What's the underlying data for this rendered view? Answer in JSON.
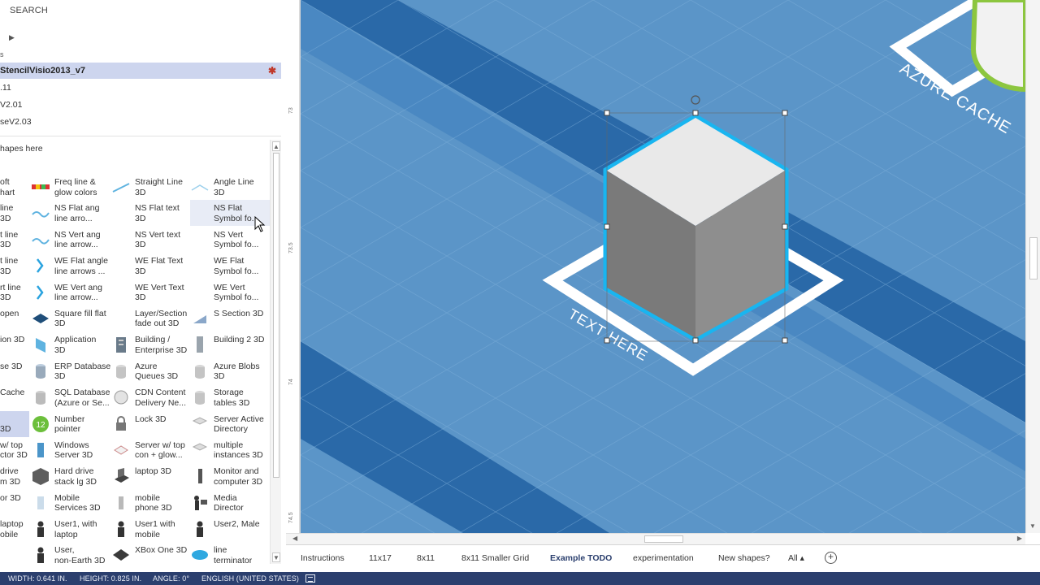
{
  "shapes_pane": {
    "search_label": "SEARCH",
    "expand_arrow": "▶",
    "tiny_mark": "s",
    "active_stencil": "StencilVisio2013_v7",
    "active_stencil_pin": "✱",
    "stencils": [
      ".11",
      "V2.01",
      "seV2.03"
    ],
    "drop_hint": "hapes here",
    "rows": [
      [
        "oft\nhart",
        "Freq line &\nglow colors",
        "Straight Line\n3D",
        "Angle Line\n3D"
      ],
      [
        "line\n3D",
        "NS Flat ang\nline arro...",
        "NS Flat text\n3D",
        "NS Flat\nSymbol fo..."
      ],
      [
        "t line\n3D",
        "NS Vert ang\nline arrow...",
        "NS Vert text\n3D",
        "NS Vert\nSymbol fo..."
      ],
      [
        "t line\n3D",
        "WE Flat angle\nline arrows ...",
        "WE Flat Text\n3D",
        "WE Flat\nSymbol fo..."
      ],
      [
        "rt line\n3D",
        "WE Vert ang\nline arrow...",
        "WE Vert Text\n3D",
        "WE Vert\nSymbol fo..."
      ],
      [
        "open",
        "Square fill flat\n3D",
        "Layer/Section\nfade out 3D",
        "S Section 3D"
      ],
      [
        "ion 3D",
        "Application\n3D",
        "Building /\nEnterprise 3D",
        "Building 2 3D"
      ],
      [
        "se 3D",
        "ERP Database\n3D",
        "Azure\nQueues 3D",
        "Azure Blobs\n3D"
      ],
      [
        "Cache",
        "SQL Database\n(Azure or Se...",
        "CDN Content\nDelivery Ne...",
        "Storage\ntables 3D"
      ],
      [
        "\n3D",
        "Number\npointer",
        "Lock 3D",
        "Server Active\nDirectory"
      ],
      [
        "w/ top\nctor 3D",
        "Windows\nServer 3D",
        "Server w/ top\ncon + glow...",
        "multiple\ninstances 3D"
      ],
      [
        "drive\nm 3D",
        "Hard drive\nstack lg 3D",
        "laptop 3D",
        "Monitor and\ncomputer 3D"
      ],
      [
        "or 3D",
        "Mobile\nServices 3D",
        "mobile\nphone 3D",
        "Media\nDirector"
      ],
      [
        "laptop\nobile",
        "User1, with\nlaptop",
        "User1 with\nmobile",
        "User2, Male"
      ],
      [
        "",
        "User,\nnon-Earth 3D",
        "XBox One 3D",
        "line\nterminator"
      ]
    ]
  },
  "canvas": {
    "text_here_label": "TEXT HERE",
    "azure_cache_label": "AZURE CACHE",
    "ruler_marks": [
      "73",
      "73.5",
      "74",
      "74.5"
    ],
    "background_color": "#5b95c8",
    "stripe_color": "#2a69a8",
    "selection_glow_color": "#19b5f0"
  },
  "page_tabs": {
    "tabs": [
      "Instructions",
      "11x17",
      "8x11",
      "8x11 Smaller Grid",
      "Example TODO",
      "experimentation",
      "New shapes?",
      "All ▴"
    ],
    "active": "Example TODO"
  },
  "status_bar": {
    "width": "WIDTH: 0.641 IN.",
    "height": "HEIGHT: 0.825 IN.",
    "angle": "ANGLE: 0°",
    "language": "ENGLISH (UNITED STATES)"
  }
}
